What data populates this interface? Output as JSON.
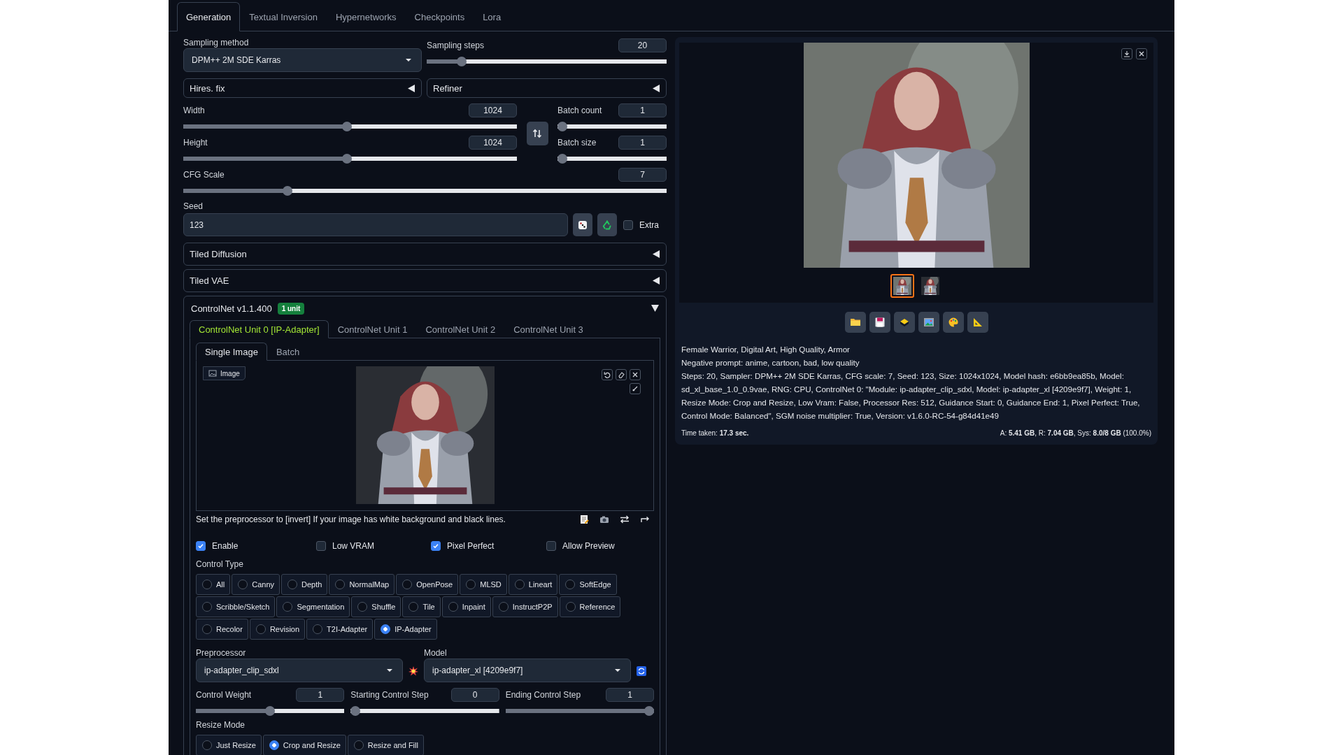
{
  "tabs": [
    {
      "label": "Generation",
      "selected": true
    },
    {
      "label": "Textual Inversion",
      "selected": false
    },
    {
      "label": "Hypernetworks",
      "selected": false
    },
    {
      "label": "Checkpoints",
      "selected": false
    },
    {
      "label": "Lora",
      "selected": false
    }
  ],
  "sampling_method": {
    "label": "Sampling method",
    "value": "DPM++ 2M SDE Karras"
  },
  "sampling_steps": {
    "label": "Sampling steps",
    "value": "20",
    "level": 0.13
  },
  "accordions": [
    {
      "label": "Hires. fix",
      "expanded": false
    },
    {
      "label": "Refiner",
      "expanded": false
    }
  ],
  "size_sliders": [
    {
      "label": "Width",
      "value": "1024",
      "level": 0.49
    },
    {
      "label": "Height",
      "value": "1024",
      "level": 0.49
    }
  ],
  "batch_sliders": [
    {
      "label": "Batch count",
      "value": "1",
      "level": 0
    },
    {
      "label": "Batch size",
      "value": "1",
      "level": 0
    }
  ],
  "cfg_scale": {
    "label": "CFG Scale",
    "value": "7",
    "level": 0.21
  },
  "seed": {
    "label": "Seed",
    "value": "123"
  },
  "extra": {
    "label": "Extra",
    "checked": false
  },
  "extensions": [
    {
      "label": "Tiled Diffusion",
      "expanded": false
    },
    {
      "label": "Tiled VAE",
      "expanded": false
    }
  ],
  "controlnet": {
    "title": "ControlNet v1.1.400",
    "badge": "1 unit",
    "expanded": true,
    "unit_tabs": [
      {
        "label": "ControlNet Unit 0 [IP-Adapter]",
        "selected": true
      },
      {
        "label": "ControlNet Unit 1",
        "selected": false
      },
      {
        "label": "ControlNet Unit 2",
        "selected": false
      },
      {
        "label": "ControlNet Unit 3",
        "selected": false
      }
    ],
    "input_tabs": [
      {
        "label": "Single Image",
        "selected": true
      },
      {
        "label": "Batch",
        "selected": false
      }
    ],
    "image_label": "Image",
    "hint": "Set the preprocessor to [invert] If your image has white background and black lines.",
    "options": [
      {
        "label": "Enable",
        "checked": true
      },
      {
        "label": "Low VRAM",
        "checked": false
      },
      {
        "label": "Pixel Perfect",
        "checked": true
      },
      {
        "label": "Allow Preview",
        "checked": false
      }
    ],
    "control_type": {
      "label": "Control Type",
      "options": [
        {
          "label": "All",
          "selected": false
        },
        {
          "label": "Canny",
          "selected": false
        },
        {
          "label": "Depth",
          "selected": false
        },
        {
          "label": "NormalMap",
          "selected": false
        },
        {
          "label": "OpenPose",
          "selected": false
        },
        {
          "label": "MLSD",
          "selected": false
        },
        {
          "label": "Lineart",
          "selected": false
        },
        {
          "label": "SoftEdge",
          "selected": false
        },
        {
          "label": "Scribble/Sketch",
          "selected": false
        },
        {
          "label": "Segmentation",
          "selected": false
        },
        {
          "label": "Shuffle",
          "selected": false
        },
        {
          "label": "Tile",
          "selected": false
        },
        {
          "label": "Inpaint",
          "selected": false
        },
        {
          "label": "InstructP2P",
          "selected": false
        },
        {
          "label": "Reference",
          "selected": false
        },
        {
          "label": "Recolor",
          "selected": false
        },
        {
          "label": "Revision",
          "selected": false
        },
        {
          "label": "T2I-Adapter",
          "selected": false
        },
        {
          "label": "IP-Adapter",
          "selected": true
        }
      ]
    },
    "preprocessor": {
      "label": "Preprocessor",
      "value": "ip-adapter_clip_sdxl"
    },
    "model": {
      "label": "Model",
      "value": "ip-adapter_xl [4209e9f7]"
    },
    "steps": [
      {
        "label": "Control Weight",
        "value": "1",
        "level": 0.5
      },
      {
        "label": "Starting Control Step",
        "value": "0",
        "level": 0
      },
      {
        "label": "Ending Control Step",
        "value": "1",
        "level": 1
      }
    ],
    "resize_mode": {
      "label": "Resize Mode",
      "options": [
        {
          "label": "Just Resize",
          "selected": false
        },
        {
          "label": "Crop and Resize",
          "selected": true
        },
        {
          "label": "Resize and Fill",
          "selected": false
        }
      ]
    }
  },
  "output": {
    "thumbnails": [
      {
        "selected": true
      },
      {
        "selected": false
      }
    ],
    "info": [
      "Female Warrior, Digital Art, High Quality, Armor",
      "Negative prompt: anime, cartoon, bad, low quality",
      "Steps: 20, Sampler: DPM++ 2M SDE Karras, CFG scale: 7, Seed: 123, Size: 1024x1024, Model hash: e6bb9ea85b, Model: sd_xl_base_1.0_0.9vae, RNG: CPU, ControlNet 0: \"Module: ip-adapter_clip_sdxl, Model: ip-adapter_xl [4209e9f7], Weight: 1, Resize Mode: Crop and Resize, Low Vram: False, Processor Res: 512, Guidance Start: 0, Guidance End: 1, Pixel Perfect: True, Control Mode: Balanced\", SGM noise multiplier: True, Version: v1.6.0-RC-54-g84d41e49"
    ],
    "time": "Time taken: **17.3 sec.**",
    "memory": "A: **5.41 GB**, R: **7.04 GB**, Sys: **8.0/8 GB** (100.0%)"
  }
}
